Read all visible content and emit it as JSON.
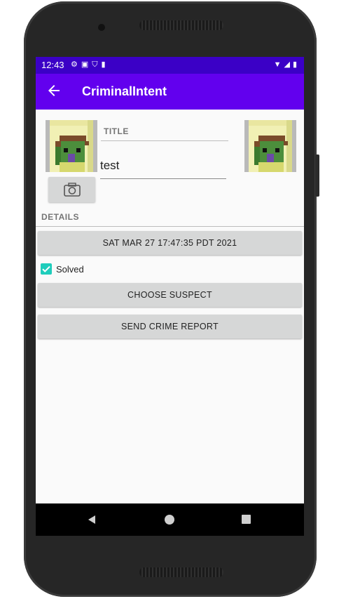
{
  "status_bar": {
    "time": "12:43",
    "left_icons": [
      "gear-icon",
      "a-icon",
      "shield-icon",
      "sd-card-icon"
    ],
    "right_icons": [
      "wifi-icon",
      "signal-icon",
      "battery-icon"
    ]
  },
  "app_bar": {
    "title": "CriminalIntent",
    "back_icon": "arrow-left-icon",
    "color": "#6200ee",
    "status_color": "#3b00c6"
  },
  "crime": {
    "title_label": "TITLE",
    "title_value": "test",
    "details_label": "DETAILS",
    "date_button": "SAT MAR 27 17:47:35 PDT 2021",
    "solved_checked": true,
    "solved_label": "Solved",
    "choose_suspect_button": "CHOOSE SUSPECT",
    "send_report_button": "SEND CRIME REPORT"
  },
  "colors": {
    "accent": "#1fcdbc",
    "button_bg": "#d6d7d7"
  },
  "nav_bar": {
    "icons": [
      "nav-back-icon",
      "nav-home-icon",
      "nav-recents-icon"
    ]
  }
}
